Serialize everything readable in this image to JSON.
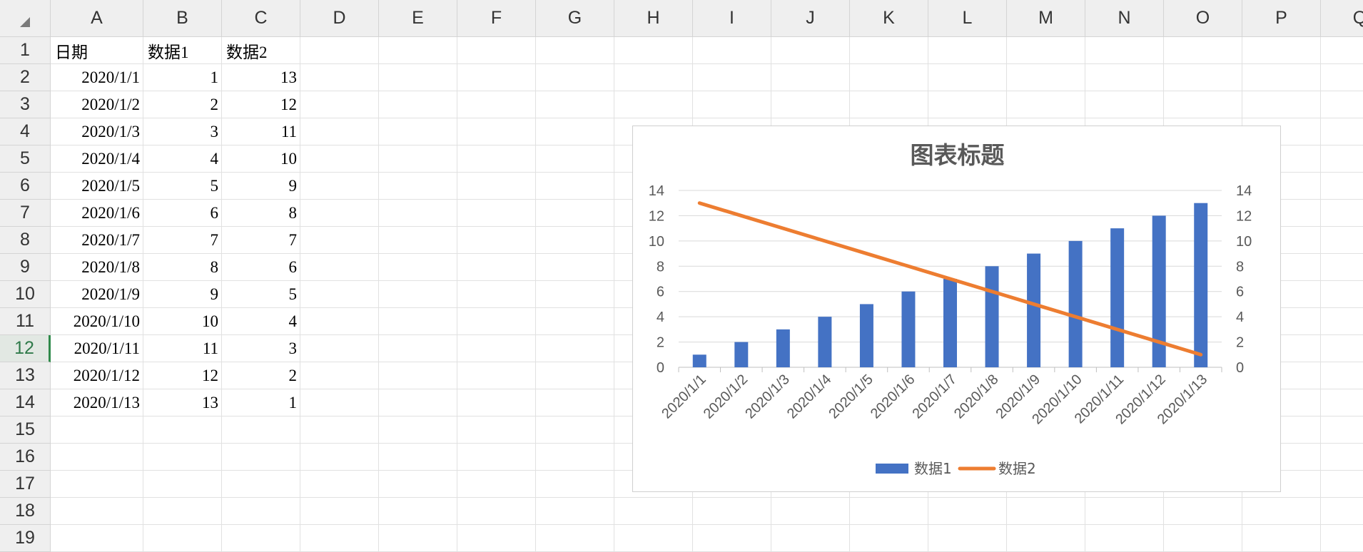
{
  "sheet": {
    "columns": [
      "A",
      "B",
      "C",
      "D",
      "E",
      "F",
      "G",
      "H",
      "I",
      "J",
      "K",
      "L",
      "M",
      "N",
      "O",
      "P",
      "Q"
    ],
    "rows": [
      "1",
      "2",
      "3",
      "4",
      "5",
      "6",
      "7",
      "8",
      "9",
      "10",
      "11",
      "12",
      "13",
      "14",
      "15",
      "16",
      "17",
      "18",
      "19"
    ],
    "active_row": "12",
    "header_row": [
      "日期",
      "数据1",
      "数据2"
    ],
    "data": [
      [
        "2020/1/1",
        "1",
        "13"
      ],
      [
        "2020/1/2",
        "2",
        "12"
      ],
      [
        "2020/1/3",
        "3",
        "11"
      ],
      [
        "2020/1/4",
        "4",
        "10"
      ],
      [
        "2020/1/5",
        "5",
        "9"
      ],
      [
        "2020/1/6",
        "6",
        "8"
      ],
      [
        "2020/1/7",
        "7",
        "7"
      ],
      [
        "2020/1/8",
        "8",
        "6"
      ],
      [
        "2020/1/9",
        "9",
        "5"
      ],
      [
        "2020/1/10",
        "10",
        "4"
      ],
      [
        "2020/1/11",
        "11",
        "3"
      ],
      [
        "2020/1/12",
        "12",
        "2"
      ],
      [
        "2020/1/13",
        "13",
        "1"
      ]
    ]
  },
  "chart_data": {
    "type": "bar",
    "title": "图表标题",
    "categories": [
      "2020/1/1",
      "2020/1/2",
      "2020/1/3",
      "2020/1/4",
      "2020/1/5",
      "2020/1/6",
      "2020/1/7",
      "2020/1/8",
      "2020/1/9",
      "2020/1/10",
      "2020/1/11",
      "2020/1/12",
      "2020/1/13"
    ],
    "series": [
      {
        "name": "数据1",
        "type": "bar",
        "axis": "left",
        "color": "#4472c4",
        "values": [
          1,
          2,
          3,
          4,
          5,
          6,
          7,
          8,
          9,
          10,
          11,
          12,
          13
        ]
      },
      {
        "name": "数据2",
        "type": "line",
        "axis": "right",
        "color": "#ed7d31",
        "values": [
          13,
          12,
          11,
          10,
          9,
          8,
          7,
          6,
          5,
          4,
          3,
          2,
          1
        ]
      }
    ],
    "ylim": [
      0,
      14
    ],
    "y2lim": [
      0,
      14
    ],
    "yticks": [
      "0",
      "2",
      "4",
      "6",
      "8",
      "10",
      "12",
      "14"
    ],
    "grid": true,
    "legend": "bottom"
  }
}
